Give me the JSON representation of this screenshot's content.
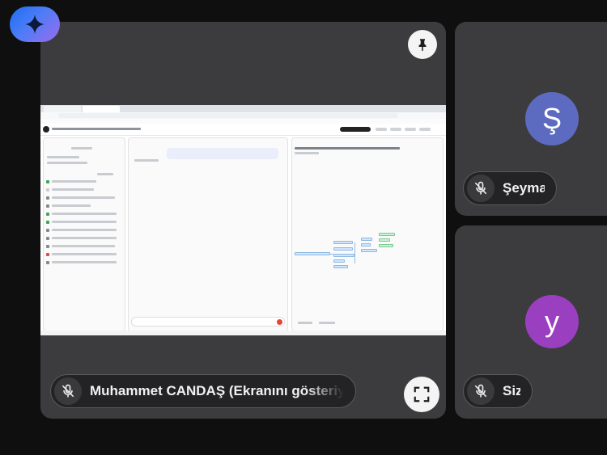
{
  "colors": {
    "background": "#0f0f10",
    "tile": "#3c3c3e",
    "avatar_seyma": "#5c6bc0",
    "avatar_y": "#9a3fc0",
    "gemini_gradient": [
      "#1b6ef3",
      "#9b6cf0"
    ]
  },
  "icons": {
    "gemini": "sparkle-icon",
    "pin": "pin-icon",
    "fullscreen": "fullscreen-icon",
    "mic_off": "mic-off-icon"
  },
  "main_tile": {
    "presenter_label": "Muhammet CANDAŞ (Ekranını gösteriyor)"
  },
  "participants": [
    {
      "initial": "Ş",
      "name": "Şeyma"
    },
    {
      "initial": "y",
      "name": "Siz"
    }
  ]
}
